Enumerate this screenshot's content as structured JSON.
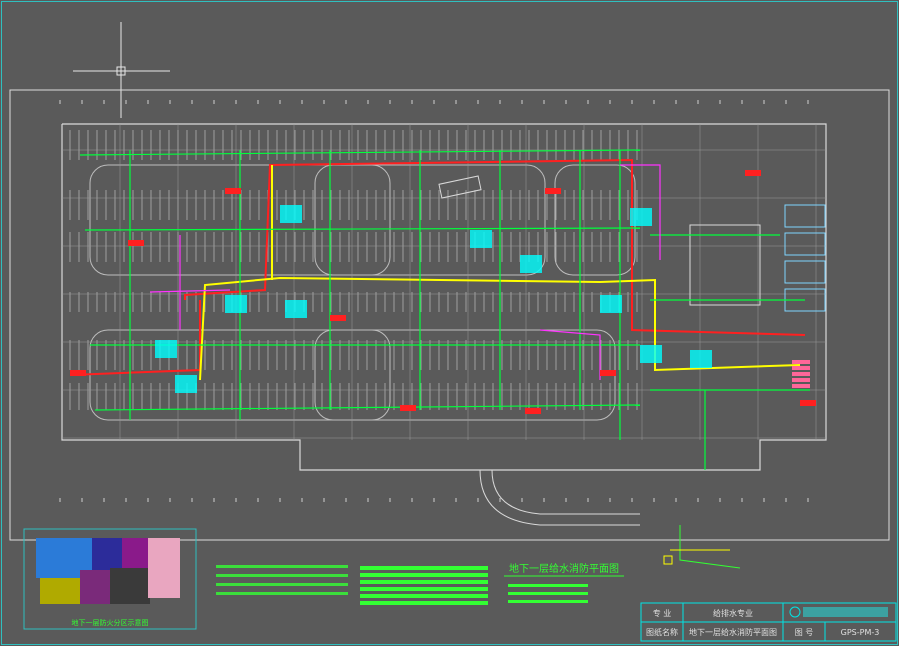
{
  "drawing": {
    "title_main": "地下一层给水消防平面图",
    "keymap_caption": "地下一层防火分区示意图",
    "title_block": {
      "specialty_label": "专  业",
      "specialty_value": "给排水专业",
      "drawing_name_label": "图纸名称",
      "drawing_name_value": "地下一层给水消防平面图",
      "drawing_no_label": "图  号",
      "drawing_no_value": "GPS-PM-3",
      "company_logo": "company-logo"
    }
  },
  "colors": {
    "background": "#5a5a5a",
    "frame": "#cfd8d8",
    "wall": "#d9d9d9",
    "pipe_green": "#00ff3c",
    "pipe_red": "#ff2020",
    "pipe_yellow": "#ffff00",
    "pipe_magenta": "#ff33ff",
    "tag_cyan": "#00ffff",
    "note_green": "#33ff33",
    "title_block_line": "#00e5e5"
  },
  "keymap_zones": [
    {
      "color": "#2b7bd8"
    },
    {
      "color": "#2c2c9a"
    },
    {
      "color": "#8a1a8a"
    },
    {
      "color": "#b0aa00"
    },
    {
      "color": "#7a2a7a"
    },
    {
      "color": "#3a3a3a"
    },
    {
      "color": "#e9a6c0"
    }
  ]
}
